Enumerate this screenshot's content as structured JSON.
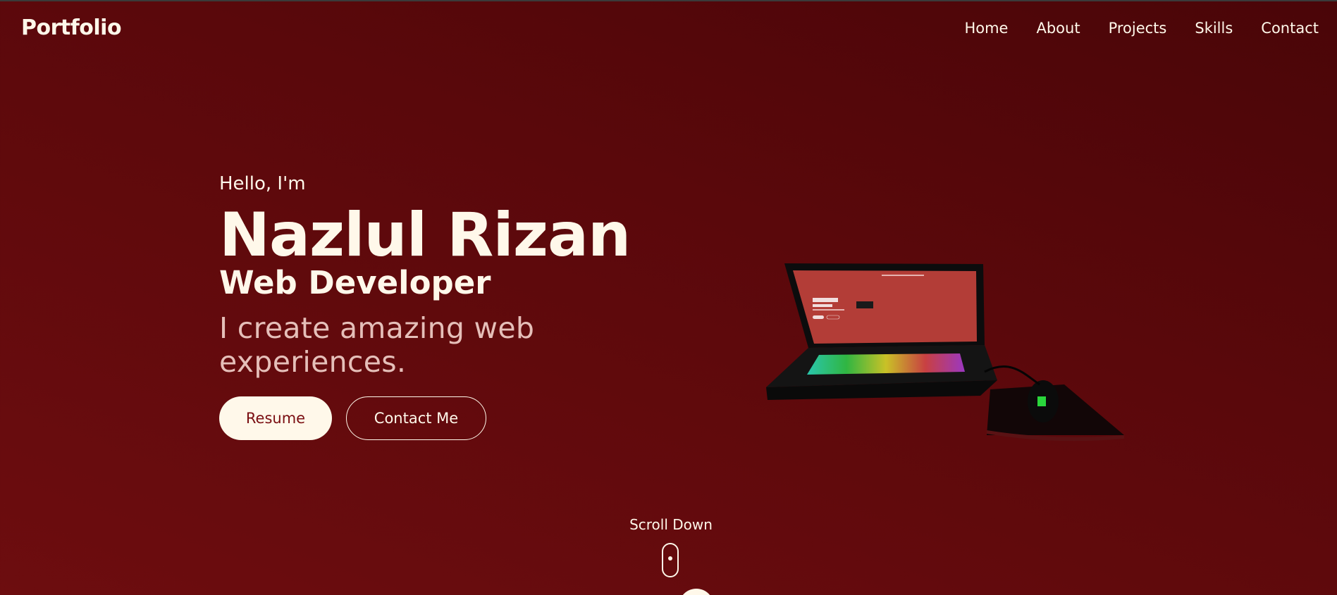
{
  "nav": {
    "brand": "Portfolio",
    "links": [
      "Home",
      "About",
      "Projects",
      "Skills",
      "Contact"
    ]
  },
  "hero": {
    "greeting": "Hello, I'm",
    "name": "Nazlul Rizan",
    "role": "Web Developer",
    "tagline": "I create amazing web experiences.",
    "buttons": {
      "primary": "Resume",
      "secondary": "Contact Me"
    },
    "illustration": "laptop-with-mouse-3d-model"
  },
  "scroll": {
    "label": "Scroll Down",
    "icon": "mouse-scroll-icon"
  },
  "colors": {
    "background": "#5a080b",
    "text": "#fff8ea",
    "accent_button_text": "#7a0e12",
    "tagline": "#e5bfb9"
  }
}
